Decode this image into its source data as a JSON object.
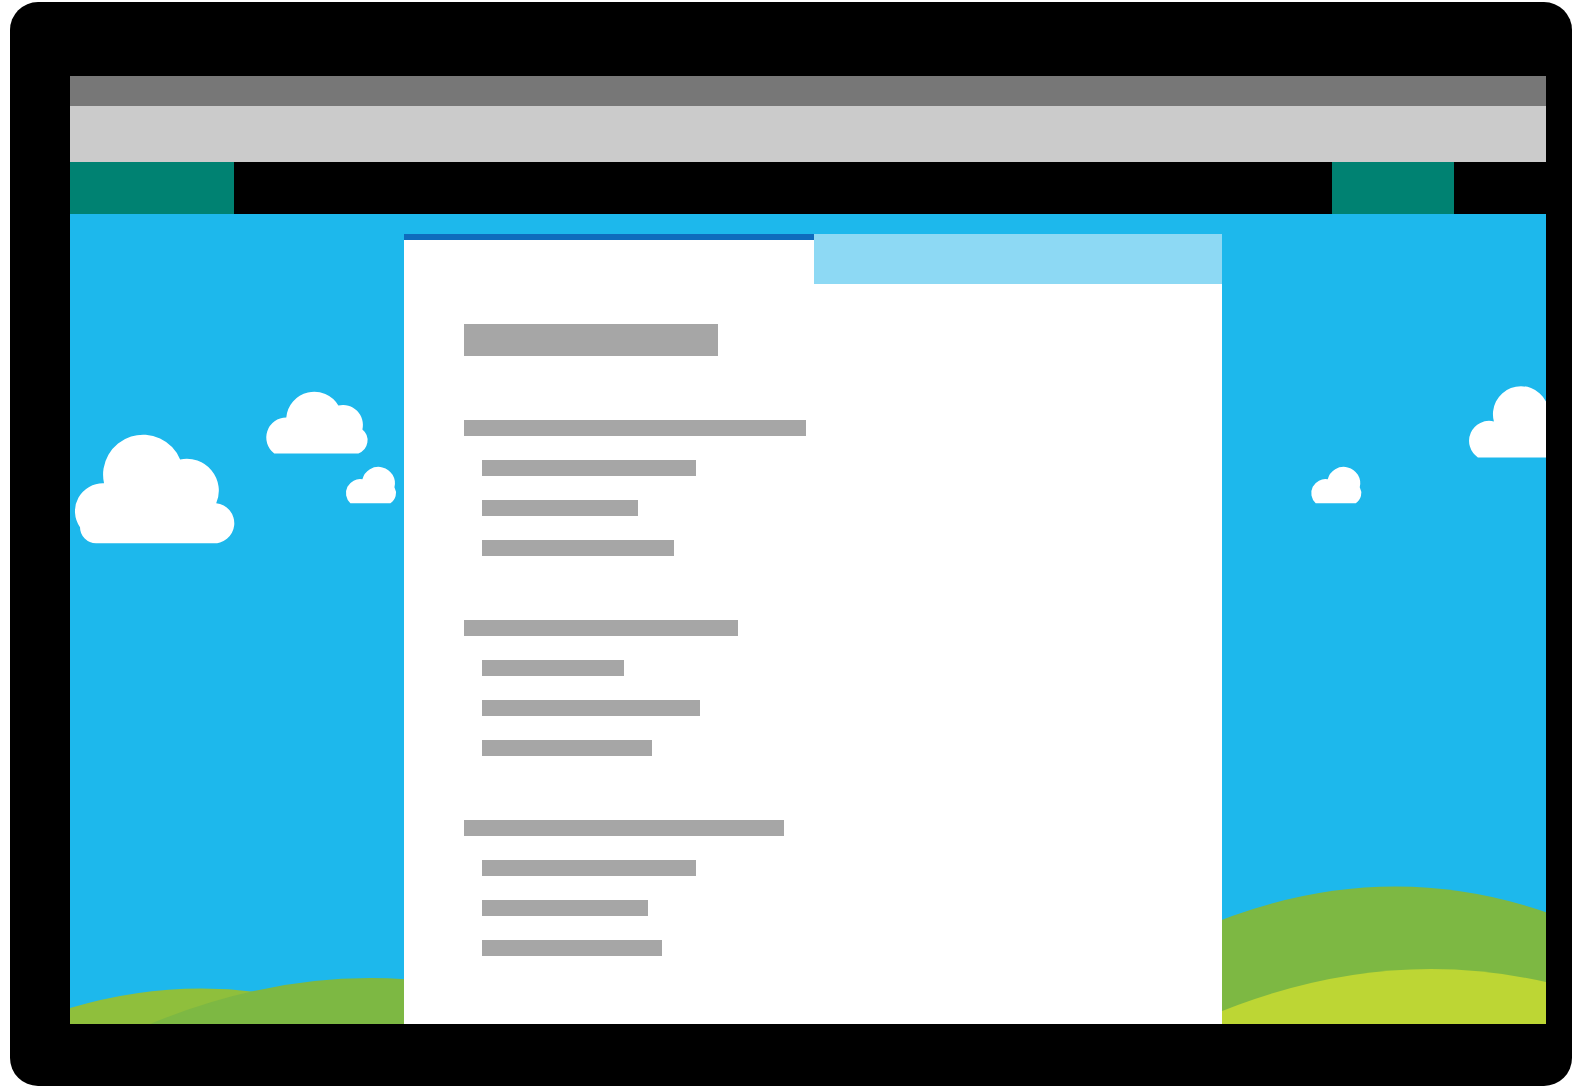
{
  "toolbar": {
    "buttons": [
      {
        "kind": "block"
      },
      {
        "kind": "block"
      }
    ]
  },
  "document": {
    "tabs": [
      {
        "selected": true
      },
      {
        "selected": false
      }
    ],
    "sections": [
      {
        "items": [
          {
            "kind": "title"
          }
        ]
      },
      {
        "items": [
          {
            "kind": "heading"
          },
          {
            "kind": "line"
          },
          {
            "kind": "line"
          },
          {
            "kind": "line"
          }
        ]
      },
      {
        "items": [
          {
            "kind": "heading"
          },
          {
            "kind": "line"
          },
          {
            "kind": "line"
          },
          {
            "kind": "line"
          }
        ]
      },
      {
        "items": [
          {
            "kind": "heading"
          },
          {
            "kind": "line"
          },
          {
            "kind": "line"
          },
          {
            "kind": "line"
          }
        ]
      }
    ]
  }
}
